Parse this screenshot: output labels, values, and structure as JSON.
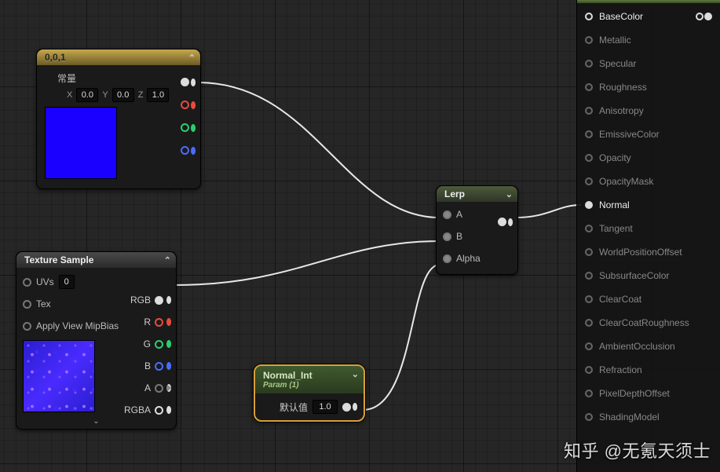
{
  "constNode": {
    "title": "0,0,1",
    "section_label": "常量",
    "x_label": "X",
    "y_label": "Y",
    "z_label": "Z",
    "x_val": "0.0",
    "y_val": "0.0",
    "z_val": "1.0",
    "swatch_color": "#1a00ff"
  },
  "texNode": {
    "title": "Texture Sample",
    "in_uvs": "UVs",
    "in_uvs_val": "0",
    "in_tex": "Tex",
    "in_mip": "Apply View MipBias",
    "out_rgb": "RGB",
    "out_r": "R",
    "out_g": "G",
    "out_b": "B",
    "out_a": "A",
    "out_rgba": "RGBA"
  },
  "lerpNode": {
    "title": "Lerp",
    "in_a": "A",
    "in_b": "B",
    "in_alpha": "Alpha"
  },
  "normalNode": {
    "title": "Normal_Int",
    "subtitle": "Param (1)",
    "default_label": "默认值",
    "default_val": "1.0"
  },
  "material": {
    "pins": [
      {
        "label": "BaseColor",
        "active": true,
        "tail": true
      },
      {
        "label": "Metallic",
        "active": false,
        "tail": false
      },
      {
        "label": "Specular",
        "active": false,
        "tail": false
      },
      {
        "label": "Roughness",
        "active": false,
        "tail": false
      },
      {
        "label": "Anisotropy",
        "active": false,
        "tail": false
      },
      {
        "label": "EmissiveColor",
        "active": false,
        "tail": false
      },
      {
        "label": "Opacity",
        "active": false,
        "tail": false
      },
      {
        "label": "OpacityMask",
        "active": false,
        "tail": false
      },
      {
        "label": "Normal",
        "active": true,
        "tail": false,
        "connected": true
      },
      {
        "label": "Tangent",
        "active": false,
        "tail": false
      },
      {
        "label": "WorldPositionOffset",
        "active": false,
        "tail": false
      },
      {
        "label": "SubsurfaceColor",
        "active": false,
        "tail": false
      },
      {
        "label": "ClearCoat",
        "active": false,
        "tail": false
      },
      {
        "label": "ClearCoatRoughness",
        "active": false,
        "tail": false
      },
      {
        "label": "AmbientOcclusion",
        "active": false,
        "tail": false
      },
      {
        "label": "Refraction",
        "active": false,
        "tail": false
      },
      {
        "label": "PixelDepthOffset",
        "active": false,
        "tail": false
      },
      {
        "label": "ShadingModel",
        "active": false,
        "tail": false
      }
    ]
  },
  "watermark": "知乎 @无氪天须士"
}
